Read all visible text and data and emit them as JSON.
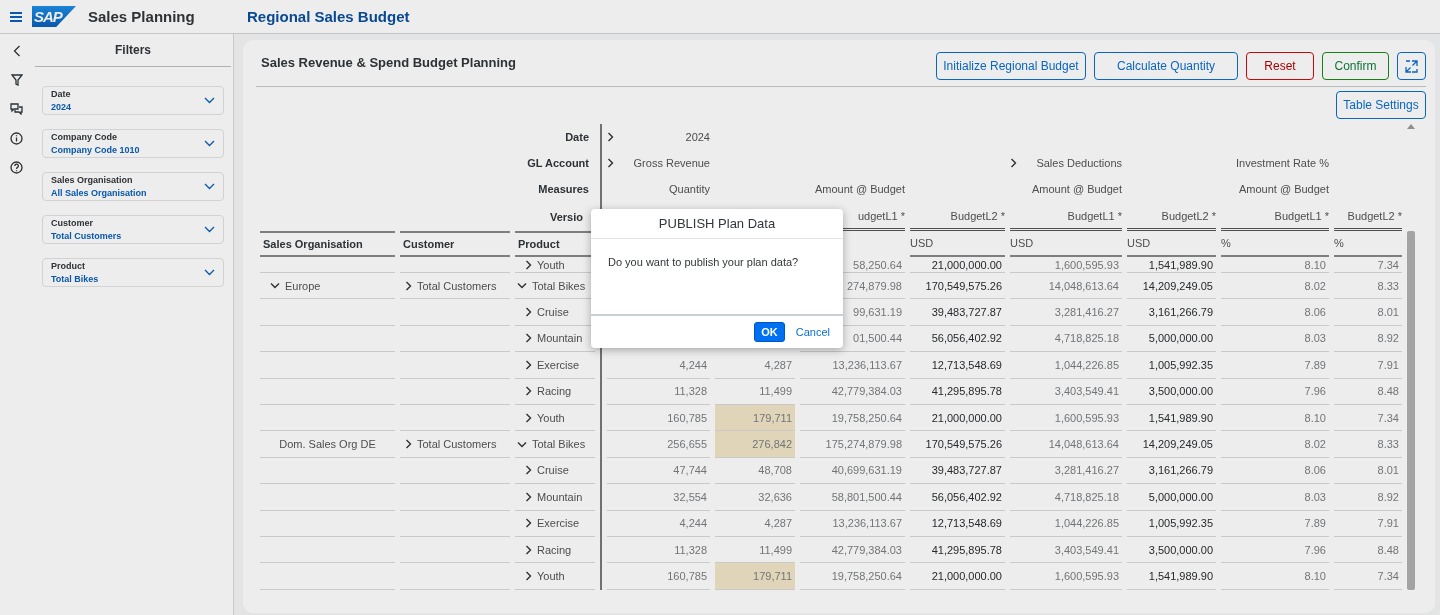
{
  "header": {
    "logo": "SAP",
    "product_title": "Sales Planning",
    "page_title": "Regional Sales Budget"
  },
  "filters": {
    "title": "Filters",
    "items": [
      {
        "label": "Date",
        "value": "2024"
      },
      {
        "label": "Company Code",
        "value": "Company Code 1010"
      },
      {
        "label": "Sales Organisation",
        "value": "All Sales Organisation"
      },
      {
        "label": "Customer",
        "value": "Total Customers"
      },
      {
        "label": "Product",
        "value": "Total Bikes"
      }
    ]
  },
  "card": {
    "title": "Sales Revenue & Spend Budget Planning",
    "actions": [
      {
        "label": "Initialize Regional Budget",
        "kind": "default"
      },
      {
        "label": "Calculate Quantity",
        "kind": "default"
      },
      {
        "label": "Reset",
        "kind": "reject"
      },
      {
        "label": "Confirm",
        "kind": "accept"
      },
      {
        "kind": "icon"
      }
    ],
    "table_settings": "Table Settings"
  },
  "table": {
    "dimension_rows": [
      {
        "label": "Date",
        "cells": {
          "quantity": {
            "text": "2024",
            "expanded": false
          }
        }
      },
      {
        "label": "GL Account",
        "cells": {
          "quantity": {
            "text": "Gross Revenue",
            "expanded": false
          },
          "deductions": {
            "text": "Sales Deductions",
            "expanded": false
          },
          "investment": {
            "text": "Investment Rate %"
          }
        }
      },
      {
        "label": "Measures",
        "cells": {
          "quantity": {
            "text": "Quantity"
          },
          "gross": {
            "text": "Amount @ Budget"
          },
          "deductions": {
            "text": "Amount @ Budget"
          },
          "investment": {
            "text": "Amount @ Budget"
          }
        }
      }
    ],
    "version_label": "Versio",
    "versions": {
      "gross_l1": "udgetL1 *",
      "gross_l2": "BudgetL2 *",
      "deductions_l1": "BudgetL1 *",
      "deductions_l2": "BudgetL2 *",
      "investment_l1": "BudgetL1 *",
      "investment_l2": "BudgetL2 *"
    },
    "row_headers": [
      "Sales Organisation",
      "Customer",
      "Product"
    ],
    "units": {
      "gross_l2": "USD",
      "deductions_l1": "USD",
      "deductions_l2": "USD",
      "investment_l1": "%",
      "investment_l2": "%"
    },
    "data_columns": {
      "quantity_l1": {
        "editable": false
      },
      "quantity_l2": {
        "editable": false
      },
      "gross_l1": {
        "editable": false
      },
      "gross_l2": {
        "editable": true
      },
      "deductions_l1": {
        "editable": false
      },
      "deductions_l2": {
        "editable": true
      },
      "investment_l1": {
        "editable": false
      },
      "investment_l2": {
        "editable": false
      }
    },
    "rows": [
      {
        "children": [
          {
            "product": {
              "text": "Youth",
              "expanded": false
            },
            "values": {
              "gross_l1": {
                "text": "58,250.64",
                "highlighted": false
              },
              "gross_l2": {
                "text": "21,000,000.00",
                "highlighted": false
              },
              "deductions_l1": {
                "text": "1,600,595.93",
                "highlighted": false
              },
              "deductions_l2": {
                "text": "1,541,989.90",
                "highlighted": false
              },
              "investment_l1": {
                "text": "8.10",
                "highlighted": false
              },
              "investment_l2": {
                "text": "7.34",
                "highlighted": false
              }
            }
          }
        ]
      },
      {
        "sales_org": {
          "text": "Europe",
          "expanded": true
        },
        "customer": {
          "text": "Total Customers",
          "expanded": false
        },
        "product": {
          "text": "Total Bikes",
          "expanded": true
        },
        "values": {
          "gross_l1": {
            "text": "274,879.98",
            "highlighted": false
          },
          "gross_l2": {
            "text": "170,549,575.26",
            "highlighted": false
          },
          "deductions_l1": {
            "text": "14,048,613.64",
            "highlighted": false
          },
          "deductions_l2": {
            "text": "14,209,249.05",
            "highlighted": false
          },
          "investment_l1": {
            "text": "8.02",
            "highlighted": false
          },
          "investment_l2": {
            "text": "8.33",
            "highlighted": false
          }
        },
        "children": [
          {
            "product": {
              "text": "Cruise",
              "expanded": false
            },
            "values": {
              "gross_l1": {
                "text": "99,631.19",
                "highlighted": false
              },
              "gross_l2": {
                "text": "39,483,727.87",
                "highlighted": false
              },
              "deductions_l1": {
                "text": "3,281,416.27",
                "highlighted": false
              },
              "deductions_l2": {
                "text": "3,161,266.79",
                "highlighted": false
              },
              "investment_l1": {
                "text": "8.06",
                "highlighted": false
              },
              "investment_l2": {
                "text": "8.01",
                "highlighted": false
              }
            }
          },
          {
            "product": {
              "text": "Mountain",
              "expanded": false
            },
            "values": {
              "gross_l1": {
                "text": "01,500.44",
                "highlighted": false
              },
              "gross_l2": {
                "text": "56,056,402.92",
                "highlighted": false
              },
              "deductions_l1": {
                "text": "4,718,825.18",
                "highlighted": false
              },
              "deductions_l2": {
                "text": "5,000,000.00",
                "highlighted": false
              },
              "investment_l1": {
                "text": "8.03",
                "highlighted": false
              },
              "investment_l2": {
                "text": "8.92",
                "highlighted": false
              }
            }
          },
          {
            "product": {
              "text": "Exercise",
              "expanded": false
            },
            "values": {
              "quantity_l1": {
                "text": "4,244",
                "highlighted": false
              },
              "quantity_l2": {
                "text": "4,287",
                "highlighted": false
              },
              "gross_l1": {
                "text": "13,236,113.67",
                "highlighted": false
              },
              "gross_l2": {
                "text": "12,713,548.69",
                "highlighted": false
              },
              "deductions_l1": {
                "text": "1,044,226.85",
                "highlighted": false
              },
              "deductions_l2": {
                "text": "1,005,992.35",
                "highlighted": false
              },
              "investment_l1": {
                "text": "7.89",
                "highlighted": false
              },
              "investment_l2": {
                "text": "7.91",
                "highlighted": false
              }
            }
          },
          {
            "product": {
              "text": "Racing",
              "expanded": false
            },
            "values": {
              "quantity_l1": {
                "text": "11,328",
                "highlighted": false
              },
              "quantity_l2": {
                "text": "11,499",
                "highlighted": false
              },
              "gross_l1": {
                "text": "42,779,384.03",
                "highlighted": false
              },
              "gross_l2": {
                "text": "41,295,895.78",
                "highlighted": false
              },
              "deductions_l1": {
                "text": "3,403,549.41",
                "highlighted": false
              },
              "deductions_l2": {
                "text": "3,500,000.00",
                "highlighted": false
              },
              "investment_l1": {
                "text": "7.96",
                "highlighted": false
              },
              "investment_l2": {
                "text": "8.48",
                "highlighted": false
              }
            }
          },
          {
            "product": {
              "text": "Youth",
              "expanded": false
            },
            "values": {
              "quantity_l1": {
                "text": "160,785",
                "highlighted": false
              },
              "quantity_l2": {
                "text": "179,711",
                "highlighted": true
              },
              "gross_l1": {
                "text": "19,758,250.64",
                "highlighted": false
              },
              "gross_l2": {
                "text": "21,000,000.00",
                "highlighted": false
              },
              "deductions_l1": {
                "text": "1,600,595.93",
                "highlighted": false
              },
              "deductions_l2": {
                "text": "1,541,989.90",
                "highlighted": false
              },
              "investment_l1": {
                "text": "8.10",
                "highlighted": false
              },
              "investment_l2": {
                "text": "7.34",
                "highlighted": false
              }
            }
          }
        ]
      },
      {
        "sales_org": {
          "text": "Dom. Sales Org DE"
        },
        "customer": {
          "text": "Total Customers",
          "expanded": false
        },
        "product": {
          "text": "Total Bikes",
          "expanded": true
        },
        "values": {
          "quantity_l1": {
            "text": "256,655",
            "highlighted": false
          },
          "quantity_l2": {
            "text": "276,842",
            "highlighted": true
          },
          "gross_l1": {
            "text": "175,274,879.98",
            "highlighted": false
          },
          "gross_l2": {
            "text": "170,549,575.26",
            "highlighted": false
          },
          "deductions_l1": {
            "text": "14,048,613.64",
            "highlighted": false
          },
          "deductions_l2": {
            "text": "14,209,249.05",
            "highlighted": false
          },
          "investment_l1": {
            "text": "8.02",
            "highlighted": false
          },
          "investment_l2": {
            "text": "8.33",
            "highlighted": false
          }
        },
        "children": [
          {
            "product": {
              "text": "Cruise",
              "expanded": false
            },
            "values": {
              "quantity_l1": {
                "text": "47,744",
                "highlighted": false
              },
              "quantity_l2": {
                "text": "48,708",
                "highlighted": false
              },
              "gross_l1": {
                "text": "40,699,631.19",
                "highlighted": false
              },
              "gross_l2": {
                "text": "39,483,727.87",
                "highlighted": false
              },
              "deductions_l1": {
                "text": "3,281,416.27",
                "highlighted": false
              },
              "deductions_l2": {
                "text": "3,161,266.79",
                "highlighted": false
              },
              "investment_l1": {
                "text": "8.06",
                "highlighted": false
              },
              "investment_l2": {
                "text": "8.01",
                "highlighted": false
              }
            }
          },
          {
            "product": {
              "text": "Mountain",
              "expanded": false
            },
            "values": {
              "quantity_l1": {
                "text": "32,554",
                "highlighted": false
              },
              "quantity_l2": {
                "text": "32,636",
                "highlighted": false
              },
              "gross_l1": {
                "text": "58,801,500.44",
                "highlighted": false
              },
              "gross_l2": {
                "text": "56,056,402.92",
                "highlighted": false
              },
              "deductions_l1": {
                "text": "4,718,825.18",
                "highlighted": false
              },
              "deductions_l2": {
                "text": "5,000,000.00",
                "highlighted": false
              },
              "investment_l1": {
                "text": "8.03",
                "highlighted": false
              },
              "investment_l2": {
                "text": "8.92",
                "highlighted": false
              }
            }
          },
          {
            "product": {
              "text": "Exercise",
              "expanded": false
            },
            "values": {
              "quantity_l1": {
                "text": "4,244",
                "highlighted": false
              },
              "quantity_l2": {
                "text": "4,287",
                "highlighted": false
              },
              "gross_l1": {
                "text": "13,236,113.67",
                "highlighted": false
              },
              "gross_l2": {
                "text": "12,713,548.69",
                "highlighted": false
              },
              "deductions_l1": {
                "text": "1,044,226.85",
                "highlighted": false
              },
              "deductions_l2": {
                "text": "1,005,992.35",
                "highlighted": false
              },
              "investment_l1": {
                "text": "7.89",
                "highlighted": false
              },
              "investment_l2": {
                "text": "7.91",
                "highlighted": false
              }
            }
          },
          {
            "product": {
              "text": "Racing",
              "expanded": false
            },
            "values": {
              "quantity_l1": {
                "text": "11,328",
                "highlighted": false
              },
              "quantity_l2": {
                "text": "11,499",
                "highlighted": false
              },
              "gross_l1": {
                "text": "42,779,384.03",
                "highlighted": false
              },
              "gross_l2": {
                "text": "41,295,895.78",
                "highlighted": false
              },
              "deductions_l1": {
                "text": "3,403,549.41",
                "highlighted": false
              },
              "deductions_l2": {
                "text": "3,500,000.00",
                "highlighted": false
              },
              "investment_l1": {
                "text": "7.96",
                "highlighted": false
              },
              "investment_l2": {
                "text": "8.48",
                "highlighted": false
              }
            }
          },
          {
            "product": {
              "text": "Youth",
              "expanded": false
            },
            "values": {
              "quantity_l1": {
                "text": "160,785",
                "highlighted": false
              },
              "quantity_l2": {
                "text": "179,711",
                "highlighted": true
              },
              "gross_l1": {
                "text": "19,758,250.64",
                "highlighted": false
              },
              "gross_l2": {
                "text": "21,000,000.00",
                "highlighted": false
              },
              "deductions_l1": {
                "text": "1,600,595.93",
                "highlighted": false
              },
              "deductions_l2": {
                "text": "1,541,989.90",
                "highlighted": false
              },
              "investment_l1": {
                "text": "8.10",
                "highlighted": false
              },
              "investment_l2": {
                "text": "7.34",
                "highlighted": false
              }
            }
          }
        ]
      }
    ]
  },
  "dialog": {
    "title": "PUBLISH Plan Data",
    "message": "Do you want to publish your plan data?",
    "buttons": [
      {
        "label": "OK",
        "kind": "emphasized"
      },
      {
        "label": "Cancel",
        "kind": "transparent"
      }
    ]
  }
}
